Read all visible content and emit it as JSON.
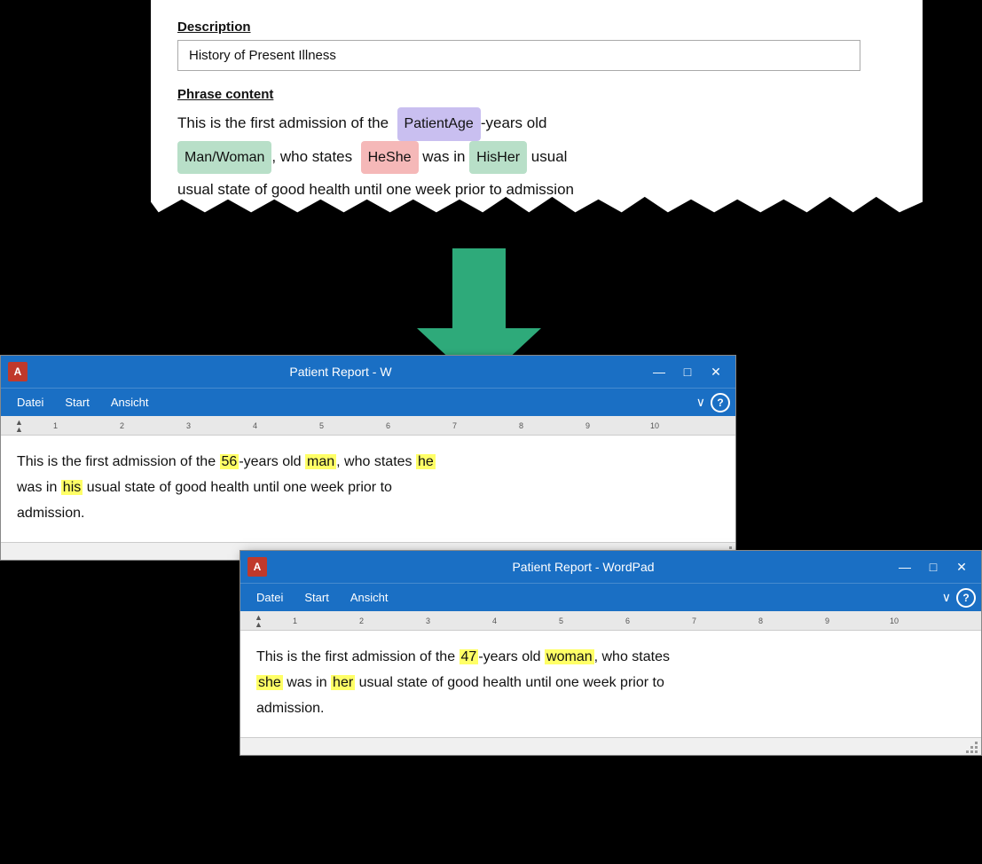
{
  "top_panel": {
    "description_label": "Description",
    "description_value": "History of Present Illness",
    "phrase_label": "Phrase content",
    "phrase": {
      "before": "This is the first admission of the",
      "tag1": "PatientAge",
      "middle1": "-years old",
      "tag2": "Man/Woman",
      "middle2": ", who states",
      "tag3": "HeShe",
      "middle3": "was in",
      "tag4": "HisHer",
      "middle4": "usual state of good health until one week prior to admission"
    }
  },
  "arrow": {
    "label": "down-arrow"
  },
  "wordpad1": {
    "title": "Patient Report - W",
    "icon_label": "A",
    "menu_items": [
      "Datei",
      "Start",
      "Ansicht"
    ],
    "content_text": "This is the first admission of the 56-years old man, who states he was in his usual state of good health until one week prior to admission.",
    "highlights": [
      "56",
      "man",
      "he",
      "his"
    ],
    "minimize": "—",
    "maximize": "□",
    "close": "✕"
  },
  "wordpad2": {
    "title": "Patient Report - WordPad",
    "icon_label": "A",
    "menu_items": [
      "Datei",
      "Start",
      "Ansicht"
    ],
    "content_text": "This is the first admission of the 47-years old woman, who states she was in her usual state of good health until one week prior to admission.",
    "highlights": [
      "47",
      "woman",
      "she",
      "her"
    ],
    "minimize": "—",
    "maximize": "□",
    "close": "✕"
  }
}
